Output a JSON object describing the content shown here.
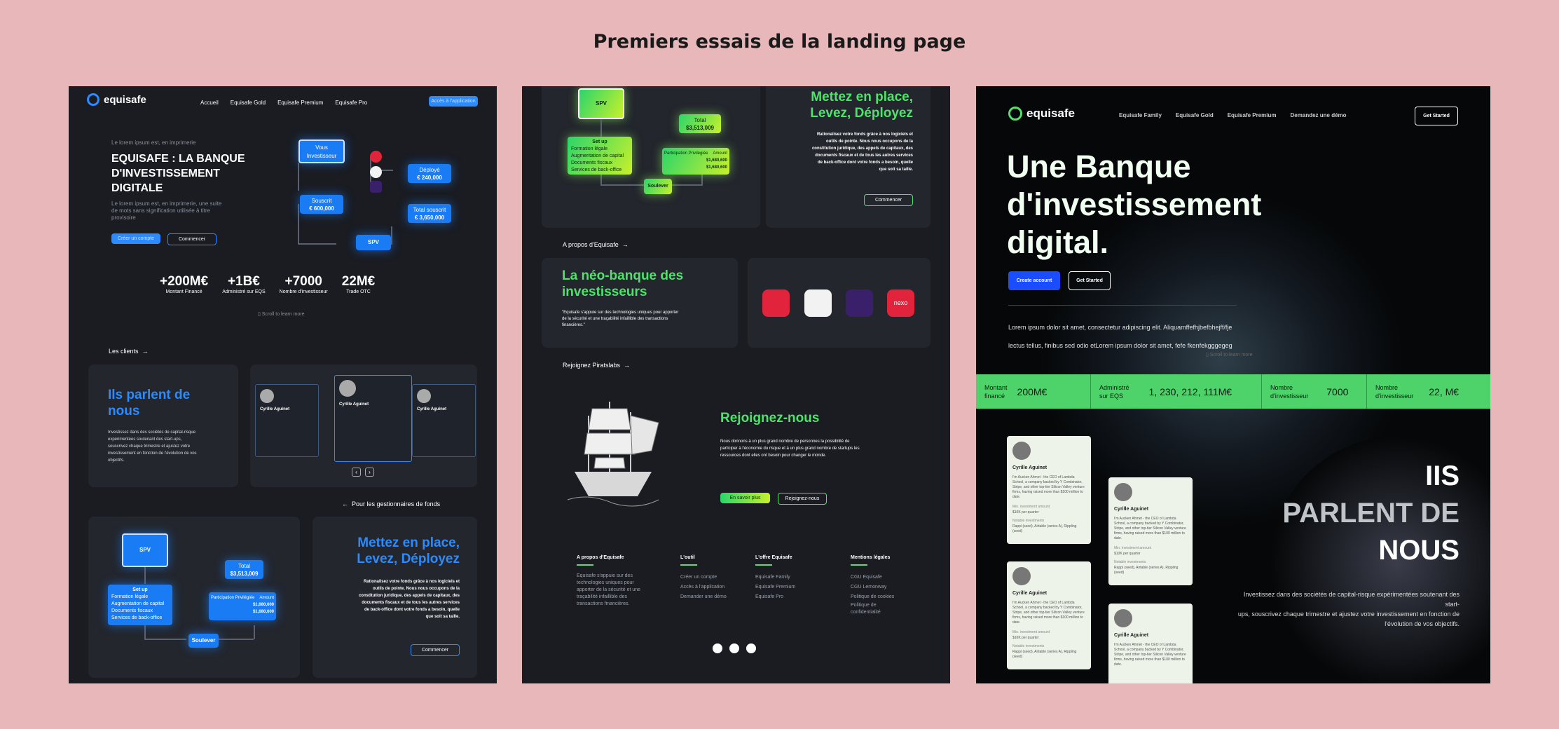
{
  "page_title": "Premiers essais de la landing page",
  "p1": {
    "logo": "equisafe",
    "nav": [
      "Accueil",
      "Equisafe Gold",
      "Equisafe Premium",
      "Equisafe Pro"
    ],
    "nav_cta": "Accès à l'application",
    "kicker": "Le lorem ipsum est, en imprimerie",
    "hero_title": [
      "EQUISAFE : LA BANQUE",
      "D'INVESTISSEMENT",
      "DIGITALE"
    ],
    "hero_sub": [
      "Le lorem ipsum est, en imprimerie, une suite",
      "de mots sans signification utilisée à titre",
      "provisoire"
    ],
    "btn_primary": "Créer un compte",
    "btn_secondary": "Commencer",
    "diagram": {
      "vous": [
        "Vous",
        "Investisseur"
      ],
      "deploye": [
        "Déployé",
        "€ 240,000"
      ],
      "souscrit": [
        "Souscrit",
        "€ 600,000"
      ],
      "total": [
        "Total souscrit",
        "€ 3,650,000"
      ],
      "spv": "SPV"
    },
    "stats": [
      {
        "v": "+200M€",
        "l": "Montant Financé"
      },
      {
        "v": "+1B€",
        "l": "Administré sur EQS"
      },
      {
        "v": "+7000",
        "l": "Nombre d'investisseur"
      },
      {
        "v": "22M€",
        "l": "Trade OTC"
      }
    ],
    "scroll": "Scroll to learn more",
    "clients": "Les clients",
    "parlent": [
      "Ils parlent de",
      "nous"
    ],
    "parlent_text": [
      "Investissez dans des sociétés de capital-risque",
      "expérimentées soutenant des start-ups,",
      "souscrivez chaque trimestre et ajustez votre",
      "investissement en fonction de l'évolution de vos",
      "objectifs."
    ],
    "testimonial_name": "Cyrille Aguinet",
    "testimonial_body": "I'm Aucken Ahmet - the CEO of Lambda School, a company backed by Y Combinator, Stripe, and other top-tier Silicon Valley venture firms, having raised more than $100 million to date.",
    "gestionnaires": "Pour les gestionnaires de fonds",
    "spv": "SPV",
    "total": [
      "Total",
      "$3,513,009"
    ],
    "setup": "Set up",
    "setup_items": [
      "Formation légale",
      "Augmentation de capital",
      "Documents fiscaux",
      "Services de back-office"
    ],
    "table_head": [
      "Participation Privilégiée",
      "Amount"
    ],
    "amounts": [
      "$1,680,600",
      "$1,680,600"
    ],
    "soulever": "Soulever",
    "mettez": [
      "Mettez en place,",
      "Levez, Déployez"
    ],
    "mettez_text": [
      "Rationalisez votre fonds grâce à nos logiciels et",
      "outils de pointe. Nous nous occupons de la",
      "constitution juridique, des appels de capitaux, des",
      "documents fiscaux et de tous les autres services",
      "de back-office dont votre fonds a besoin, quelle",
      "que soit sa taille."
    ],
    "commencer": "Commencer"
  },
  "p2": {
    "spv": "SPV",
    "total": [
      "Total",
      "$3,513,009"
    ],
    "setup": "Set up",
    "setup_items": [
      "Formation légale",
      "Augmentation de capital",
      "Documents fiscaux",
      "Services de back-office"
    ],
    "table_head": [
      "Participation Privilégiée",
      "Amount"
    ],
    "amounts": [
      "$1,680,600",
      "$1,680,600"
    ],
    "soulever": "Soulever",
    "mettez": [
      "Mettez en place,",
      "Levez, Déployez"
    ],
    "mettez_text": [
      "Rationalisez votre fonds grâce à nos logiciels et",
      "outils de pointe. Nous nous occupons de la",
      "constitution juridique, des appels de capitaux, des",
      "documents fiscaux et de tous les autres services",
      "de back-office dont votre fonds a besoin, quelle",
      "que soit sa taille."
    ],
    "commencer": "Commencer",
    "apropos": "A propos d'Equisafe",
    "neo": [
      "La néo-banque des",
      "investisseurs"
    ],
    "neo_text": [
      "\"Equisafe s'appuie sur des technologies uniques pour apporter",
      "de la sécurité et une traçabilité infaillible des transactions",
      "financières.\""
    ],
    "partner_nexo": "nexo",
    "rejoignez_link": "Rejoignez Piratslabs",
    "rejoignez_title": "Rejoignez-nous",
    "rejoignez_text": [
      "Nous donnons à un plus grand nombre de personnes la possibilité de",
      "participer à l'économie du risque et à un plus grand nombre de startups les",
      "ressources dont elles ont besoin pour changer le monde."
    ],
    "en_savoir": "En savoir plus",
    "rejoignez_btn": "Rejoignez-nous",
    "footer": [
      {
        "h": "A propos d'Equisafe",
        "items": [
          "Equisafe s'appuie sur des",
          "technologies uniques pour",
          "apporter de la sécurité et une",
          "traçabilité infaillible des",
          "transactions financières."
        ]
      },
      {
        "h": "L'outil",
        "items": [
          "Créer un compte",
          "Accès à l'application",
          "Demander une démo"
        ]
      },
      {
        "h": "L'offre Equisafe",
        "items": [
          "Equisafe Family",
          "Equisafe Premium",
          "Equisafe Pro"
        ]
      },
      {
        "h": "Mentions légales",
        "items": [
          "CGU Equisafe",
          "CGU Lemonway",
          "Politique de cookies",
          "Politique de",
          "confidentialité"
        ]
      }
    ]
  },
  "p3": {
    "logo": "equisafe",
    "nav": [
      "Equisafe Family",
      "Equisafe Gold",
      "Equisafe Premium",
      "Demandez une démo"
    ],
    "get_started": "Get Started",
    "hero": [
      "Une Banque",
      "d'investissement",
      "digital."
    ],
    "create": "Create account",
    "get_started2": "Get Started",
    "lorem": [
      "Lorem ipsum dolor sit amet, consectetur adipiscing elit. Aliquamffefhjbefbhejff/fje",
      "lectus tellus, finibus sed odio etLorem ipsum dolor sit amet, fefe fkenfekgggegeg"
    ],
    "scroll": "Scroll to learn more",
    "stats": [
      {
        "l": [
          "Montant",
          "financé"
        ],
        "v": "200M€"
      },
      {
        "l": [
          "Administré",
          "sur EQS"
        ],
        "v": "1, 230, 212, 111M€"
      },
      {
        "l": [
          "Nombre",
          "d'investisseur"
        ],
        "v": "7000"
      },
      {
        "l": [
          "Nombre",
          "d'investisseur"
        ],
        "v": "22, M€"
      }
    ],
    "parlent": [
      "IIS",
      "PARLENT DE",
      "NOUS"
    ],
    "parlent_text": [
      "Investissez dans des sociétés de capital-risque expérimentées soutenant des",
      "start-",
      "ups, souscrivez chaque trimestre et ajustez votre investissement en fonction de",
      "l'évolution de vos objectifs."
    ],
    "testimonial_name": "Cyrille Aguinet",
    "t_body": "I'm Aucken Ahmet - the CEO of Lambda School, a company backed by Y Combinator, Stripe, and other top-tier Silicon Valley venture firms, having raised more than $100 million to date.",
    "t_min": "Min. investment amount",
    "t_min_v": "$10K per quarter",
    "t_notable": "Notable investments",
    "t_notable_v": "Rappi (seed), Airtable (series A), Rippling (seed)"
  }
}
